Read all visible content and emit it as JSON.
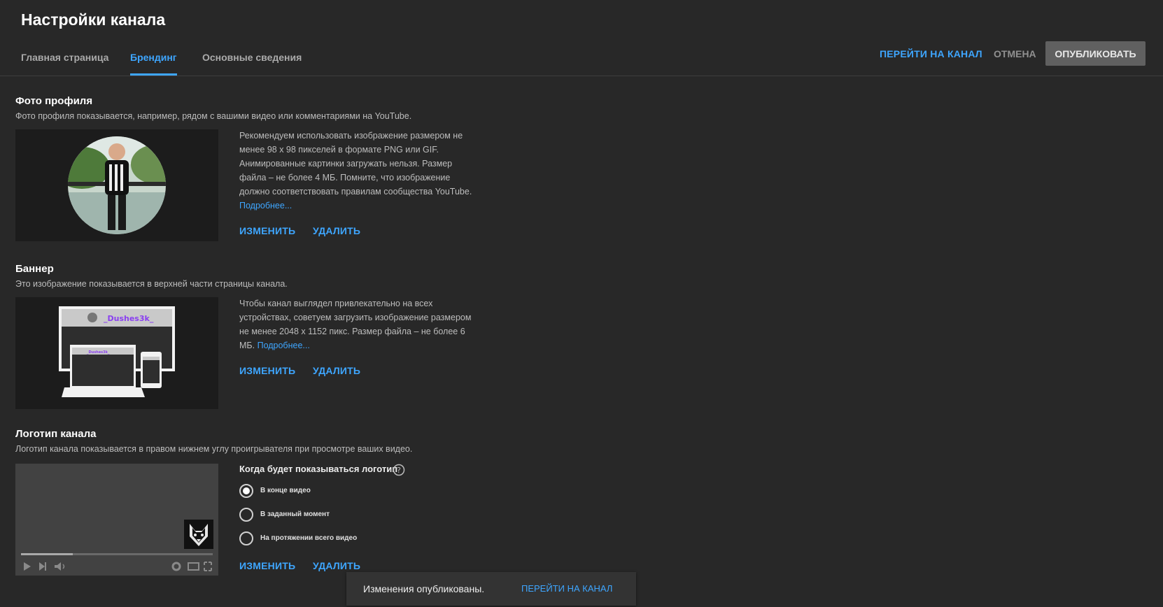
{
  "page_title": "Настройки канала",
  "tabs": [
    {
      "label": "Главная страница"
    },
    {
      "label": "Брендинг",
      "active": true
    },
    {
      "label": "Основные сведения"
    }
  ],
  "actions": {
    "view_channel": "ПЕРЕЙТИ НА КАНАЛ",
    "cancel": "ОТМЕНА",
    "publish": "ОПУБЛИКОВАТЬ"
  },
  "profile_photo": {
    "title": "Фото профиля",
    "description": "Фото профиля показывается, например, рядом с вашими видео или комментариями на YouTube.",
    "info": "Рекомендуем использовать изображение размером не менее 98 x 98 пикселей в формате PNG или GIF. Анимированные картинки загружать нельзя. Размер файла – не более 4 МБ. Помните, что изображение должно соответствовать правилам сообщества YouTube.",
    "learn_more": "Подробнее...",
    "change": "ИЗМЕНИТЬ",
    "delete": "УДАЛИТЬ"
  },
  "banner": {
    "title": "Баннер",
    "description": "Это изображение показывается в верхней части страницы канала.",
    "info": "Чтобы канал выглядел привлекательно на всех устройствах, советуем загрузить изображение размером не менее 2048 x 1152 пикс. Размер файла – не более 6 МБ.",
    "learn_more": "Подробнее...",
    "preview_text": "_Dushes3k_",
    "change": "ИЗМЕНИТЬ",
    "delete": "УДАЛИТЬ"
  },
  "watermark": {
    "title": "Логотип канала",
    "description": "Логотип канала показывается в правом нижнем углу проигрывателя при просмотре ваших видео.",
    "when_label": "Когда будет показываться логотип",
    "options": [
      {
        "label": "В конце видео",
        "checked": true
      },
      {
        "label": "В заданный момент",
        "checked": false
      },
      {
        "label": "На протяжении всего видео",
        "checked": false
      }
    ],
    "player_progress": 0.27,
    "change": "ИЗМЕНИТЬ",
    "delete": "УДАЛИТЬ"
  },
  "toast": {
    "message": "Изменения опубликованы.",
    "action": "ПЕРЕЙТИ НА КАНАЛ"
  },
  "colors": {
    "background": "#282828",
    "accent": "#3ea6ff",
    "publish_button": "#606060"
  }
}
